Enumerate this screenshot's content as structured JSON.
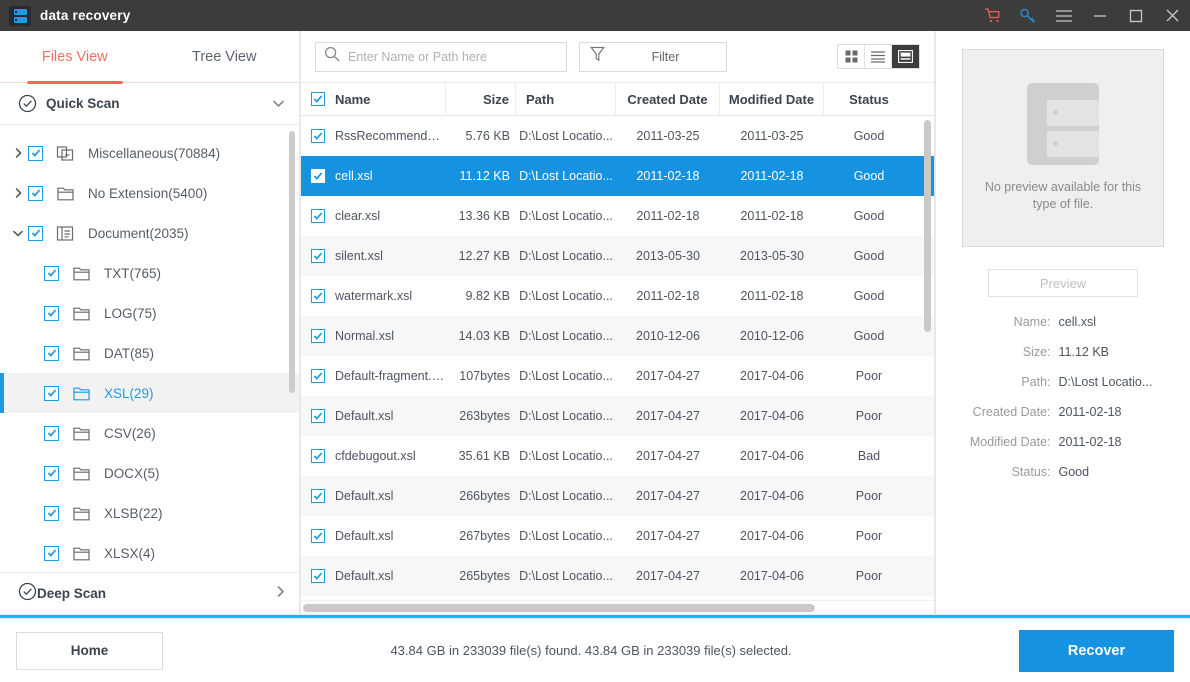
{
  "titlebar": {
    "app_title": "data recovery",
    "logo_icon": "app-logo-icon",
    "actions": [
      {
        "name": "cart-icon",
        "label": "Cart",
        "color": "#e8614a"
      },
      {
        "name": "key-icon",
        "label": "Register",
        "color": "#2196dd"
      },
      {
        "name": "menu-icon",
        "label": "Menu",
        "color": "#c8c8c8"
      },
      {
        "name": "minimize-icon",
        "label": "Minimize",
        "color": "#c8c8c8"
      },
      {
        "name": "maximize-icon",
        "label": "Maximize",
        "color": "#c8c8c8"
      },
      {
        "name": "close-icon",
        "label": "Close",
        "color": "#c8c8c8"
      }
    ]
  },
  "sidebar": {
    "tabs": [
      {
        "label": "Files View",
        "active": true
      },
      {
        "label": "Tree View",
        "active": false
      }
    ],
    "quick_scan": {
      "label": "Quick Scan",
      "icon": "check-circle-icon",
      "chevron": "chevron-down-icon",
      "expanded": true
    },
    "deep_scan": {
      "label": "Deep Scan",
      "icon": "check-circle-icon",
      "chevron": "chevron-right-icon",
      "expanded": false
    },
    "tree": [
      {
        "label": "Miscellaneous(70884)",
        "checked": true,
        "arrow": "chevron-right-icon",
        "icon": "copy-folder-icon",
        "child": false,
        "selected": false
      },
      {
        "label": "No Extension(5400)",
        "checked": true,
        "arrow": "chevron-right-icon",
        "icon": "folder-icon",
        "child": false,
        "selected": false
      },
      {
        "label": "Document(2035)",
        "checked": true,
        "arrow": "chevron-down-icon",
        "icon": "document-folder-icon",
        "child": false,
        "selected": false
      },
      {
        "label": "TXT(765)",
        "checked": true,
        "arrow": "",
        "icon": "folder-icon",
        "child": true,
        "selected": false
      },
      {
        "label": "LOG(75)",
        "checked": true,
        "arrow": "",
        "icon": "folder-icon",
        "child": true,
        "selected": false
      },
      {
        "label": "DAT(85)",
        "checked": true,
        "arrow": "",
        "icon": "folder-icon",
        "child": true,
        "selected": false
      },
      {
        "label": "XSL(29)",
        "checked": true,
        "arrow": "",
        "icon": "folder-icon",
        "child": true,
        "selected": true
      },
      {
        "label": "CSV(26)",
        "checked": true,
        "arrow": "",
        "icon": "folder-icon",
        "child": true,
        "selected": false
      },
      {
        "label": "DOCX(5)",
        "checked": true,
        "arrow": "",
        "icon": "folder-icon",
        "child": true,
        "selected": false
      },
      {
        "label": "XLSB(22)",
        "checked": true,
        "arrow": "",
        "icon": "folder-icon",
        "child": true,
        "selected": false
      },
      {
        "label": "XLSX(4)",
        "checked": true,
        "arrow": "",
        "icon": "folder-icon",
        "child": true,
        "selected": false
      }
    ]
  },
  "toolbar": {
    "search_placeholder": "Enter Name or Path here",
    "search_value": "",
    "search_icon": "search-icon",
    "filter_label": "Filter",
    "filter_icon": "funnel-icon",
    "view_modes": [
      {
        "name": "grid-view-icon",
        "active": false
      },
      {
        "name": "list-view-icon",
        "active": false
      },
      {
        "name": "detail-view-icon",
        "active": true
      }
    ]
  },
  "table": {
    "select_all_checked": true,
    "columns": [
      "Name",
      "Size",
      "Path",
      "Created Date",
      "Modified Date",
      "Status"
    ],
    "rows": [
      {
        "checked": true,
        "name": "RssRecommendati...",
        "size": "5.76 KB",
        "path": "D:\\Lost Locatio...",
        "created": "2011-03-25",
        "modified": "2011-03-25",
        "status": "Good",
        "selected": false
      },
      {
        "checked": true,
        "name": "cell.xsl",
        "size": "11.12 KB",
        "path": "D:\\Lost Locatio...",
        "created": "2011-02-18",
        "modified": "2011-02-18",
        "status": "Good",
        "selected": true
      },
      {
        "checked": true,
        "name": "clear.xsl",
        "size": "13.36 KB",
        "path": "D:\\Lost Locatio...",
        "created": "2011-02-18",
        "modified": "2011-02-18",
        "status": "Good",
        "selected": false
      },
      {
        "checked": true,
        "name": "silent.xsl",
        "size": "12.27 KB",
        "path": "D:\\Lost Locatio...",
        "created": "2013-05-30",
        "modified": "2013-05-30",
        "status": "Good",
        "selected": false
      },
      {
        "checked": true,
        "name": "watermark.xsl",
        "size": "9.82 KB",
        "path": "D:\\Lost Locatio...",
        "created": "2011-02-18",
        "modified": "2011-02-18",
        "status": "Good",
        "selected": false
      },
      {
        "checked": true,
        "name": "Normal.xsl",
        "size": "14.03 KB",
        "path": "D:\\Lost Locatio...",
        "created": "2010-12-06",
        "modified": "2010-12-06",
        "status": "Good",
        "selected": false
      },
      {
        "checked": true,
        "name": "Default-fragment.xsl",
        "size": "107bytes",
        "path": "D:\\Lost Locatio...",
        "created": "2017-04-27",
        "modified": "2017-04-06",
        "status": "Poor",
        "selected": false
      },
      {
        "checked": true,
        "name": "Default.xsl",
        "size": "263bytes",
        "path": "D:\\Lost Locatio...",
        "created": "2017-04-27",
        "modified": "2017-04-06",
        "status": "Poor",
        "selected": false
      },
      {
        "checked": true,
        "name": "cfdebugout.xsl",
        "size": "35.61 KB",
        "path": "D:\\Lost Locatio...",
        "created": "2017-04-27",
        "modified": "2017-04-06",
        "status": "Bad",
        "selected": false
      },
      {
        "checked": true,
        "name": "Default.xsl",
        "size": "266bytes",
        "path": "D:\\Lost Locatio...",
        "created": "2017-04-27",
        "modified": "2017-04-06",
        "status": "Poor",
        "selected": false
      },
      {
        "checked": true,
        "name": "Default.xsl",
        "size": "267bytes",
        "path": "D:\\Lost Locatio...",
        "created": "2017-04-27",
        "modified": "2017-04-06",
        "status": "Poor",
        "selected": false
      },
      {
        "checked": true,
        "name": "Default.xsl",
        "size": "265bytes",
        "path": "D:\\Lost Locatio...",
        "created": "2017-04-27",
        "modified": "2017-04-06",
        "status": "Poor",
        "selected": false
      }
    ]
  },
  "preview": {
    "no_preview_text": "No preview available for this type of file.",
    "preview_button": "Preview",
    "file_icon": "file-placeholder-icon",
    "fields": [
      {
        "key": "Name:",
        "value": "cell.xsl"
      },
      {
        "key": "Size:",
        "value": "11.12 KB"
      },
      {
        "key": "Path:",
        "value": "D:\\Lost Locatio..."
      },
      {
        "key": "Created Date:",
        "value": "2011-02-18"
      },
      {
        "key": "Modified Date:",
        "value": "2011-02-18"
      },
      {
        "key": "Status:",
        "value": "Good"
      }
    ]
  },
  "footer": {
    "home_label": "Home",
    "status_text": "43.84 GB in 233039 file(s) found.  43.84 GB in 233039 file(s) selected.",
    "recover_label": "Recover",
    "accent_color": "#1693e0",
    "cyan_color": "#00c2f0"
  }
}
